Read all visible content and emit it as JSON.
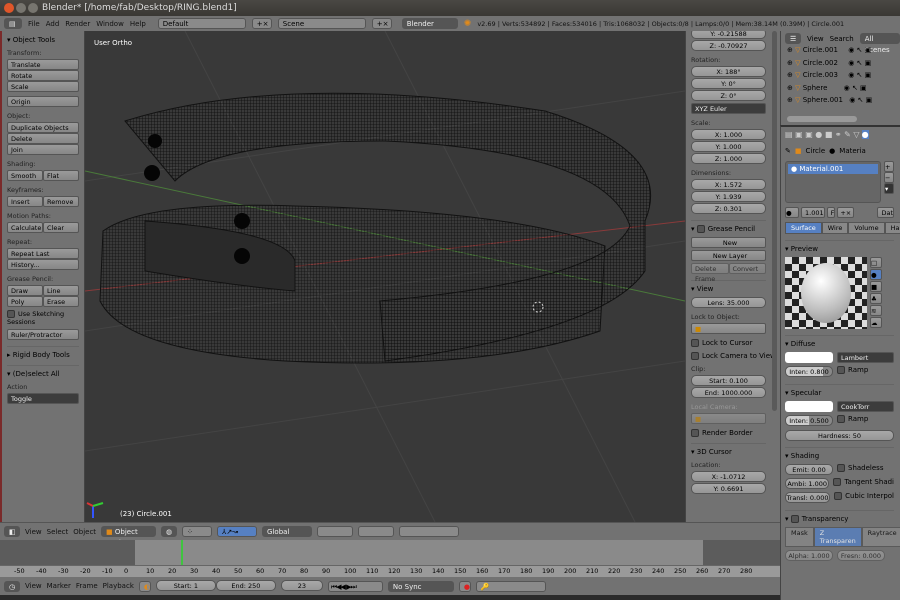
{
  "window": {
    "title": "Blender* [/home/fab/Desktop/RING.blend1]"
  },
  "info": {
    "menus": [
      "File",
      "Add",
      "Render",
      "Window",
      "Help"
    ],
    "screen": "Default",
    "scene": "Scene",
    "engine": "Blender Render",
    "stats": "v2.69 | Verts:534892 | Faces:534016 | Tris:1068032 | Objects:0/8 | Lamps:0/0 | Mem:38.14M (0.39M) | Circle.001"
  },
  "toolshelf": {
    "title": "Object Tools",
    "transform_label": "Transform:",
    "translate": "Translate",
    "rotate": "Rotate",
    "scale": "Scale",
    "origin": "Origin",
    "object_label": "Object:",
    "duplicate": "Duplicate Objects",
    "delete": "Delete",
    "join": "Join",
    "shading_label": "Shading:",
    "smooth": "Smooth",
    "flat": "Flat",
    "keyframes_label": "Keyframes:",
    "insert": "Insert",
    "remove": "Remove",
    "motion_label": "Motion Paths:",
    "calculate": "Calculate",
    "clear": "Clear",
    "repeat_label": "Repeat:",
    "repeat_last": "Repeat Last",
    "history": "History...",
    "grease_label": "Grease Pencil:",
    "draw": "Draw",
    "line": "Line",
    "poly": "Poly",
    "erase": "Erase",
    "sketching": "Use Sketching Sessions",
    "ruler": "Ruler/Protractor",
    "rigid": "Rigid Body Tools",
    "deselect": "(De)select All",
    "action_label": "Action",
    "action_value": "Toggle"
  },
  "viewport": {
    "view_label": "User Ortho",
    "object_label": "(23) Circle.001"
  },
  "npanel": {
    "loc_y": "Y: -0.21588",
    "loc_z": "Z: -0.70927",
    "rotation_label": "Rotation:",
    "rot_x": "X: 188°",
    "rot_y": "Y: 0°",
    "rot_z": "Z: 0°",
    "rot_mode": "XYZ Euler",
    "scale_label": "Scale:",
    "sc_x": "X: 1.000",
    "sc_y": "Y: 1.000",
    "sc_z": "Z: 1.000",
    "dim_label": "Dimensions:",
    "dim_x": "X: 1.572",
    "dim_y": "Y: 1.939",
    "dim_z": "Z: 0.301",
    "grease": "Grease Pencil",
    "new": "New",
    "new_layer": "New Layer",
    "delete_frame": "Delete Frame",
    "convert": "Convert",
    "view": "View",
    "lens": "Lens: 35.000",
    "lock_obj": "Lock to Object:",
    "lock_cursor": "Lock to Cursor",
    "lock_cam": "Lock Camera to View",
    "clip": "Clip:",
    "clip_start": "Start: 0.100",
    "clip_end": "End: 1000.000",
    "local_cam": "Local Camera:",
    "render_border": "Render Border",
    "cursor3d": "3D Cursor",
    "location": "Location:",
    "cur_x": "X: -1.0712",
    "cur_y": "Y: 0.6691"
  },
  "outliner": {
    "view": "View",
    "search": "Search",
    "scenes": "All Scenes",
    "items": [
      "Circle.001",
      "Circle.002",
      "Circle.003",
      "Sphere",
      "Sphere.001"
    ]
  },
  "properties": {
    "crumb_obj": "Circle",
    "crumb_mat": "Materia",
    "material": "Material.001",
    "mat_num": "1.001",
    "mat_f": "F",
    "data": "Dat",
    "tabs": [
      "Surface",
      "Wire",
      "Volume",
      "Halo"
    ],
    "preview": "Preview",
    "diffuse": "Diffuse",
    "diff_shader": "Lambert",
    "diff_inten": "Inten: 0.800",
    "ramp": "Ramp",
    "specular": "Specular",
    "spec_shader": "CookTorr",
    "spec_inten": "Inten: 0.500",
    "hardness": "Hardness: 50",
    "shading": "Shading",
    "emit": "Emit: 0.00",
    "ambi": "Ambi: 1.000",
    "transl": "Transl: 0.000",
    "shadeless": "Shadeless",
    "tangent": "Tangent Shadi",
    "cubic": "Cubic Interpol",
    "transparency": "Transparency",
    "tr_tabs": [
      "Mask",
      "Z Transparen",
      "Raytrace"
    ],
    "alpha": "Alpha: 1.000",
    "fresnel": "Fresn: 0.000"
  },
  "header3d": {
    "menus": [
      "View",
      "Select",
      "Object"
    ],
    "mode": "Object Mode",
    "orientation": "Global"
  },
  "timeline": {
    "ticks": [
      "-50",
      "-40",
      "-30",
      "-20",
      "-10",
      "0",
      "10",
      "20",
      "30",
      "40",
      "50",
      "60",
      "70",
      "80",
      "90",
      "100",
      "110",
      "120",
      "130",
      "140",
      "150",
      "160",
      "170",
      "180",
      "190",
      "200",
      "210",
      "220",
      "230",
      "240",
      "250",
      "260",
      "270",
      "280"
    ],
    "current_frame": 23,
    "menus": [
      "View",
      "Marker",
      "Frame",
      "Playback"
    ],
    "start": "Start: 1",
    "end": "End: 250",
    "frame": "23",
    "sync": "No Sync"
  },
  "colors": {
    "accent": "#5680c2",
    "panel": "#727272",
    "viewport": "#393939",
    "playhead": "#3fc43f"
  }
}
